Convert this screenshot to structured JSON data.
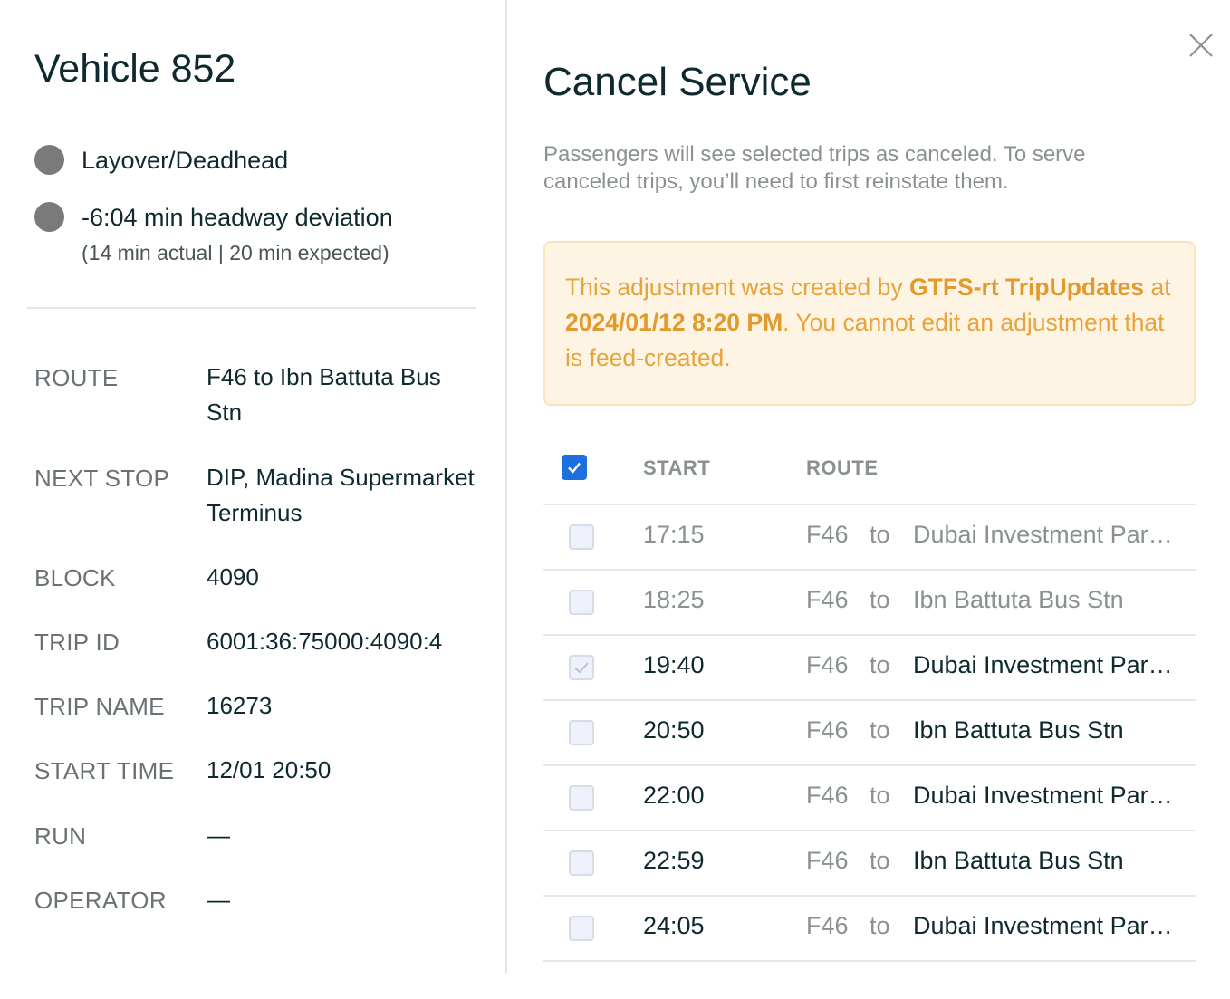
{
  "vehicle": {
    "title": "Vehicle 852",
    "status_primary": "Layover/Deadhead",
    "status_secondary": "-6:04 min headway deviation",
    "status_secondary_sub": "(14 min actual | 20 min expected)",
    "status_dot_color": "#7a7a7a"
  },
  "details": [
    {
      "label": "ROUTE",
      "value": "F46 to Ibn Battuta Bus Stn"
    },
    {
      "label": "NEXT STOP",
      "value": "DIP, Madina Supermarket Terminus"
    },
    {
      "label": "BLOCK",
      "value": "4090"
    },
    {
      "label": "TRIP ID",
      "value": "6001:36:75000:4090:4"
    },
    {
      "label": "TRIP NAME",
      "value": "16273"
    },
    {
      "label": "START TIME",
      "value": "12/01 20:50"
    },
    {
      "label": "RUN",
      "value": "—"
    },
    {
      "label": "OPERATOR",
      "value": "—"
    }
  ],
  "modal": {
    "title": "Cancel Service",
    "description": "Passengers will see selected trips as canceled. To serve canceled trips, you’ll need to first reinstate them.",
    "alert": {
      "pre": "This adjustment was created by ",
      "source": "GTFS-rt TripUpdates",
      "mid": " at ",
      "datetime": "2024/01/12 8:20 PM",
      "post": ". You cannot edit an adjustment that is feed-created."
    },
    "close_icon": "close-icon"
  },
  "table": {
    "headers": {
      "start": "START",
      "route": "ROUTE"
    },
    "header_checked": true,
    "rows": [
      {
        "start": "17:15",
        "route": "F46",
        "to": "to",
        "dest": "Dubai Investment Park (DIP), Madina Supermarket Terminus",
        "checked": false,
        "past": true
      },
      {
        "start": "18:25",
        "route": "F46",
        "to": "to",
        "dest": "Ibn Battuta Bus Stn",
        "checked": false,
        "past": true
      },
      {
        "start": "19:40",
        "route": "F46",
        "to": "to",
        "dest": "Dubai Investment Park (DIP), Madina Supermarket Terminus",
        "checked": true,
        "past": false
      },
      {
        "start": "20:50",
        "route": "F46",
        "to": "to",
        "dest": "Ibn Battuta Bus Stn",
        "checked": false,
        "past": false
      },
      {
        "start": "22:00",
        "route": "F46",
        "to": "to",
        "dest": "Dubai Investment Park (DIP), Madina Supermarket Terminus",
        "checked": false,
        "past": false
      },
      {
        "start": "22:59",
        "route": "F46",
        "to": "to",
        "dest": "Ibn Battuta Bus Stn",
        "checked": false,
        "past": false
      },
      {
        "start": "24:05",
        "route": "F46",
        "to": "to",
        "dest": "Dubai Investment Park (DIP), Madina Supermarket Terminus",
        "checked": false,
        "past": false
      }
    ]
  },
  "colors": {
    "accent": "#1d6fe0",
    "alert_bg": "#fdf4e3",
    "alert_text": "#e8a43c"
  }
}
